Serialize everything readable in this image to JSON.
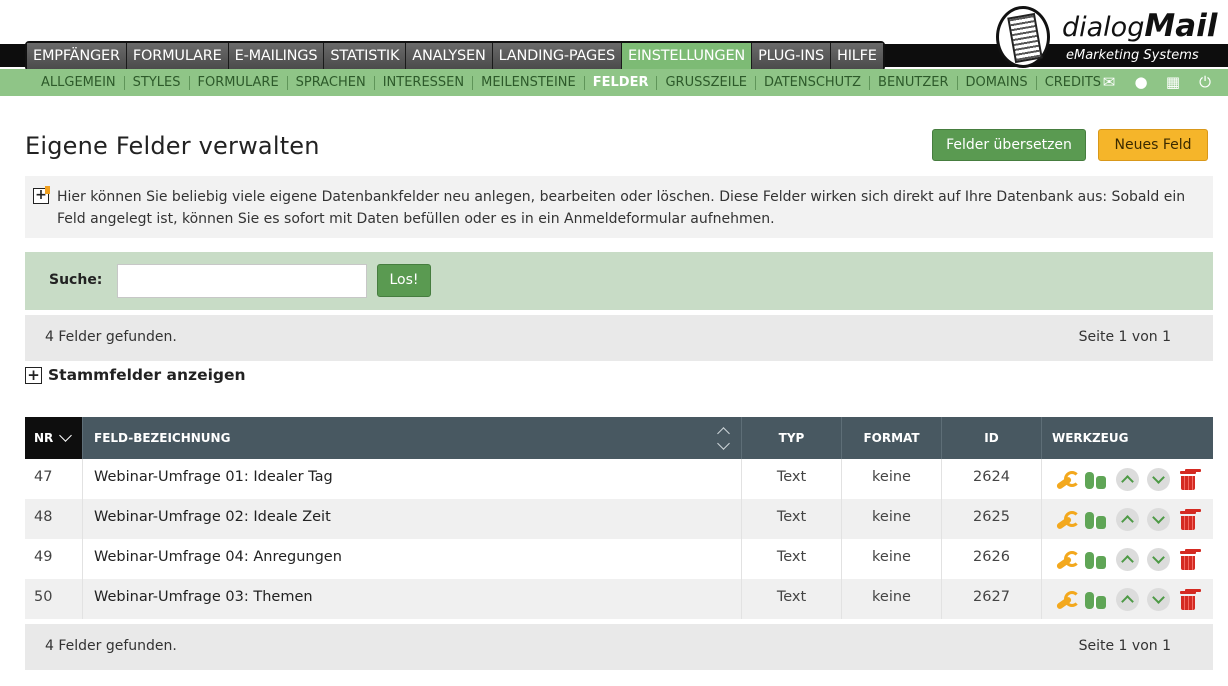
{
  "brand": {
    "prefix": "dialog",
    "name": "Mail",
    "tagline": "eMarketing Systems"
  },
  "main_nav": [
    {
      "label": "EMPFÄNGER",
      "active": false
    },
    {
      "label": "FORMULARE",
      "active": false
    },
    {
      "label": "E-MAILINGS",
      "active": false
    },
    {
      "label": "STATISTIK",
      "active": false
    },
    {
      "label": "ANALYSEN",
      "active": false
    },
    {
      "label": "LANDING-PAGES",
      "active": false
    },
    {
      "label": "EINSTELLUNGEN",
      "active": true
    },
    {
      "label": "PLUG-INS",
      "active": false
    },
    {
      "label": "HILFE",
      "active": false
    }
  ],
  "sub_nav": [
    {
      "label": "ALLGEMEIN",
      "active": false
    },
    {
      "label": "STYLES",
      "active": false
    },
    {
      "label": "FORMULARE",
      "active": false
    },
    {
      "label": "SPRACHEN",
      "active": false
    },
    {
      "label": "INTERESSEN",
      "active": false
    },
    {
      "label": "MEILENSTEINE",
      "active": false
    },
    {
      "label": "FELDER",
      "active": true
    },
    {
      "label": "GRUSSZEILE",
      "active": false
    },
    {
      "label": "DATENSCHUTZ",
      "active": false
    },
    {
      "label": "BENUTZER",
      "active": false
    },
    {
      "label": "DOMAINS",
      "active": false
    },
    {
      "label": "CREDITS",
      "active": false
    }
  ],
  "header_icons": [
    "envelope-icon",
    "user-icon",
    "sitemap-icon",
    "power-icon"
  ],
  "page": {
    "title": "Eigene Felder verwalten",
    "translate_button": "Felder übersetzen",
    "new_button": "Neues Feld",
    "info_text": "Hier können Sie beliebig viele eigene Datenbankfelder neu anlegen, bearbeiten oder löschen. Diese Felder wirken sich direkt auf Ihre Datenbank aus: Sobald ein Feld angelegt ist, können Sie es sofort mit Daten befüllen oder es in ein Anmeldeformular aufnehmen."
  },
  "search": {
    "label": "Suche:",
    "value": "",
    "placeholder": "",
    "button": "Los!"
  },
  "results": {
    "count_text": "4 Felder gefunden.",
    "page_text": "Seite 1 von 1"
  },
  "stammfelder_label": "Stammfelder anzeigen",
  "table": {
    "headers": {
      "nr": "NR",
      "feld": "FELD-BEZEICHNUNG",
      "typ": "TYP",
      "format": "FORMAT",
      "id": "ID",
      "werkzeug": "WERKZEUG"
    },
    "rows": [
      {
        "nr": "47",
        "feld": "Webinar-Umfrage 01: Idealer Tag",
        "typ": "Text",
        "format": "keine",
        "id": "2624"
      },
      {
        "nr": "48",
        "feld": "Webinar-Umfrage 02: Ideale Zeit",
        "typ": "Text",
        "format": "keine",
        "id": "2625"
      },
      {
        "nr": "49",
        "feld": "Webinar-Umfrage 04: Anregungen",
        "typ": "Text",
        "format": "keine",
        "id": "2626"
      },
      {
        "nr": "50",
        "feld": "Webinar-Umfrage 03: Themen",
        "typ": "Text",
        "format": "keine",
        "id": "2627"
      }
    ]
  },
  "colors": {
    "accent_green": "#5a9a51",
    "accent_orange": "#f5b52a",
    "subnav_green": "#8fc587",
    "table_header": "#485861",
    "delete_red": "#d42a22"
  }
}
